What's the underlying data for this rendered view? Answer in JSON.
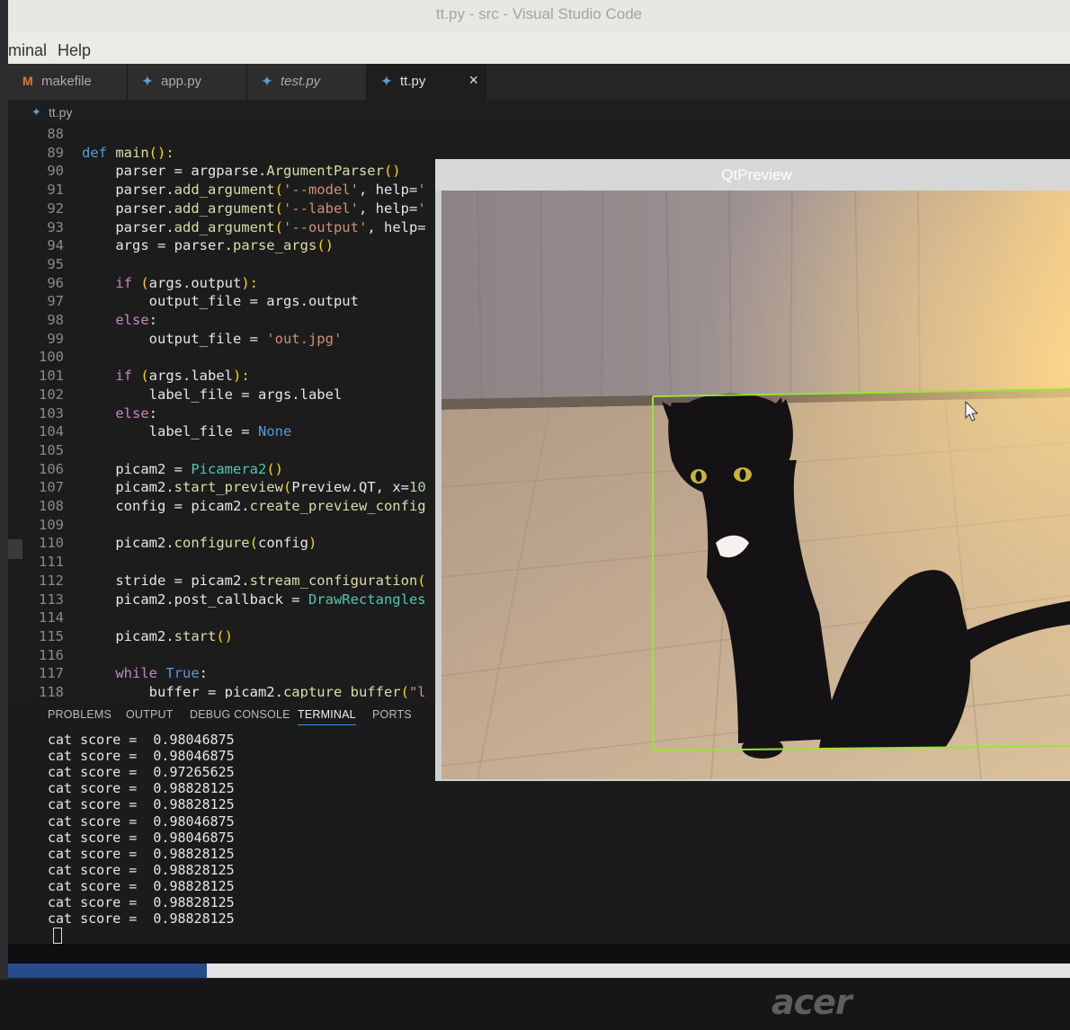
{
  "window": {
    "title": "tt.py - src - Visual Studio Code"
  },
  "menu": {
    "items": [
      "minal",
      "Help"
    ]
  },
  "tabs": [
    {
      "label": "makefile",
      "icon": "makefile-icon"
    },
    {
      "label": "app.py",
      "icon": "python-icon"
    },
    {
      "label": "test.py",
      "icon": "python-icon"
    },
    {
      "label": "tt.py",
      "icon": "python-icon",
      "active": true
    }
  ],
  "tab_close_glyph": "×",
  "breadcrumb": {
    "file": "tt.py"
  },
  "editor": {
    "lines": [
      {
        "n": "88",
        "indent": "",
        "tokens": []
      },
      {
        "n": "89",
        "indent": "",
        "tokens": [
          [
            "kw",
            "def "
          ],
          [
            "fn",
            "main"
          ],
          [
            "pn",
            "():"
          ]
        ]
      },
      {
        "n": "90",
        "indent": "    ",
        "tokens": [
          [
            "vr",
            "parser = argparse."
          ],
          [
            "fn",
            "ArgumentParser"
          ],
          [
            "pn",
            "()"
          ]
        ]
      },
      {
        "n": "91",
        "indent": "    ",
        "tokens": [
          [
            "vr",
            "parser."
          ],
          [
            "fn",
            "add_argument"
          ],
          [
            "pn",
            "("
          ],
          [
            "st",
            "'--model'"
          ],
          [
            "vr",
            ", "
          ],
          [
            "vr",
            "help="
          ],
          [
            "st",
            "'"
          ]
        ]
      },
      {
        "n": "92",
        "indent": "    ",
        "tokens": [
          [
            "vr",
            "parser."
          ],
          [
            "fn",
            "add_argument"
          ],
          [
            "pn",
            "("
          ],
          [
            "st",
            "'--label'"
          ],
          [
            "vr",
            ", "
          ],
          [
            "vr",
            "help="
          ],
          [
            "st",
            "'"
          ]
        ]
      },
      {
        "n": "93",
        "indent": "    ",
        "tokens": [
          [
            "vr",
            "parser."
          ],
          [
            "fn",
            "add_argument"
          ],
          [
            "pn",
            "("
          ],
          [
            "st",
            "'--output'"
          ],
          [
            "vr",
            ", "
          ],
          [
            "vr",
            "help="
          ]
        ]
      },
      {
        "n": "94",
        "indent": "    ",
        "tokens": [
          [
            "vr",
            "args = parser."
          ],
          [
            "fn",
            "parse_args"
          ],
          [
            "pn",
            "()"
          ]
        ]
      },
      {
        "n": "95",
        "indent": "",
        "tokens": []
      },
      {
        "n": "96",
        "indent": "    ",
        "tokens": [
          [
            "kc",
            "if "
          ],
          [
            "pn",
            "("
          ],
          [
            "vr",
            "args.output"
          ],
          [
            "pn",
            "):"
          ]
        ]
      },
      {
        "n": "97",
        "indent": "        ",
        "tokens": [
          [
            "vr",
            "output_file = args.output"
          ]
        ]
      },
      {
        "n": "98",
        "indent": "    ",
        "tokens": [
          [
            "kc",
            "else"
          ],
          [
            "vr",
            ":"
          ]
        ]
      },
      {
        "n": "99",
        "indent": "        ",
        "tokens": [
          [
            "vr",
            "output_file = "
          ],
          [
            "st",
            "'out.jpg'"
          ]
        ]
      },
      {
        "n": "100",
        "indent": "",
        "tokens": []
      },
      {
        "n": "101",
        "indent": "    ",
        "tokens": [
          [
            "kc",
            "if "
          ],
          [
            "pn",
            "("
          ],
          [
            "vr",
            "args.label"
          ],
          [
            "pn",
            "):"
          ]
        ]
      },
      {
        "n": "102",
        "indent": "        ",
        "tokens": [
          [
            "vr",
            "label_file = args.label"
          ]
        ]
      },
      {
        "n": "103",
        "indent": "    ",
        "tokens": [
          [
            "kc",
            "else"
          ],
          [
            "vr",
            ":"
          ]
        ]
      },
      {
        "n": "104",
        "indent": "        ",
        "tokens": [
          [
            "vr",
            "label_file = "
          ],
          [
            "kw",
            "None"
          ]
        ]
      },
      {
        "n": "105",
        "indent": "",
        "tokens": []
      },
      {
        "n": "106",
        "indent": "    ",
        "tokens": [
          [
            "vr",
            "picam2 = "
          ],
          [
            "cl",
            "Picamera2"
          ],
          [
            "pn",
            "()"
          ]
        ]
      },
      {
        "n": "107",
        "indent": "    ",
        "tokens": [
          [
            "vr",
            "picam2."
          ],
          [
            "fn",
            "start_preview"
          ],
          [
            "pn",
            "("
          ],
          [
            "vr",
            "Preview.QT, "
          ],
          [
            "vr",
            "x="
          ],
          [
            "nm",
            "10"
          ]
        ]
      },
      {
        "n": "108",
        "indent": "    ",
        "tokens": [
          [
            "vr",
            "config = picam2."
          ],
          [
            "fn",
            "create_preview_config"
          ]
        ]
      },
      {
        "n": "109",
        "indent": "",
        "tokens": []
      },
      {
        "n": "110",
        "indent": "    ",
        "tokens": [
          [
            "vr",
            "picam2."
          ],
          [
            "fn",
            "configure"
          ],
          [
            "pn",
            "("
          ],
          [
            "vr",
            "config"
          ],
          [
            "pn",
            ")"
          ]
        ]
      },
      {
        "n": "111",
        "indent": "",
        "tokens": []
      },
      {
        "n": "112",
        "indent": "    ",
        "tokens": [
          [
            "vr",
            "stride = picam2."
          ],
          [
            "fn",
            "stream_configuration"
          ],
          [
            "pn",
            "("
          ]
        ]
      },
      {
        "n": "113",
        "indent": "    ",
        "tokens": [
          [
            "vr",
            "picam2.post_callback = "
          ],
          [
            "cl",
            "DrawRectangles"
          ]
        ]
      },
      {
        "n": "114",
        "indent": "",
        "tokens": []
      },
      {
        "n": "115",
        "indent": "    ",
        "tokens": [
          [
            "vr",
            "picam2."
          ],
          [
            "fn",
            "start"
          ],
          [
            "pn",
            "()"
          ]
        ]
      },
      {
        "n": "116",
        "indent": "",
        "tokens": []
      },
      {
        "n": "117",
        "indent": "    ",
        "tokens": [
          [
            "kc",
            "while "
          ],
          [
            "kw",
            "True"
          ],
          [
            "vr",
            ":"
          ]
        ]
      },
      {
        "n": "118",
        "indent": "        ",
        "tokens": [
          [
            "vr",
            "buffer = picam2."
          ],
          [
            "fn",
            "capture_buffer"
          ],
          [
            "pn",
            "("
          ],
          [
            "st",
            "\"l"
          ]
        ]
      }
    ]
  },
  "panel": {
    "tabs": [
      "PROBLEMS",
      "OUTPUT",
      "DEBUG CONSOLE",
      "TERMINAL",
      "PORTS"
    ],
    "active_tab": "TERMINAL",
    "terminal_lines": [
      "cat score =  0.98046875",
      "cat score =  0.98046875",
      "cat score =  0.97265625",
      "cat score =  0.98828125",
      "cat score =  0.98828125",
      "cat score =  0.98046875",
      "cat score =  0.98046875",
      "cat score =  0.98828125",
      "cat score =  0.98828125",
      "cat score =  0.98828125",
      "cat score =  0.98828125",
      "cat score =  0.98828125"
    ]
  },
  "qt_preview": {
    "title": "QtPreview",
    "detection_color": "#9be33a"
  },
  "bezel": {
    "brand": "acer"
  },
  "colors": {
    "editor_bg": "#1e1e1e",
    "keyword": "#569cd6",
    "string": "#ce9178",
    "function": "#dcdcaa",
    "taskbar_blue": "#274b8c"
  }
}
